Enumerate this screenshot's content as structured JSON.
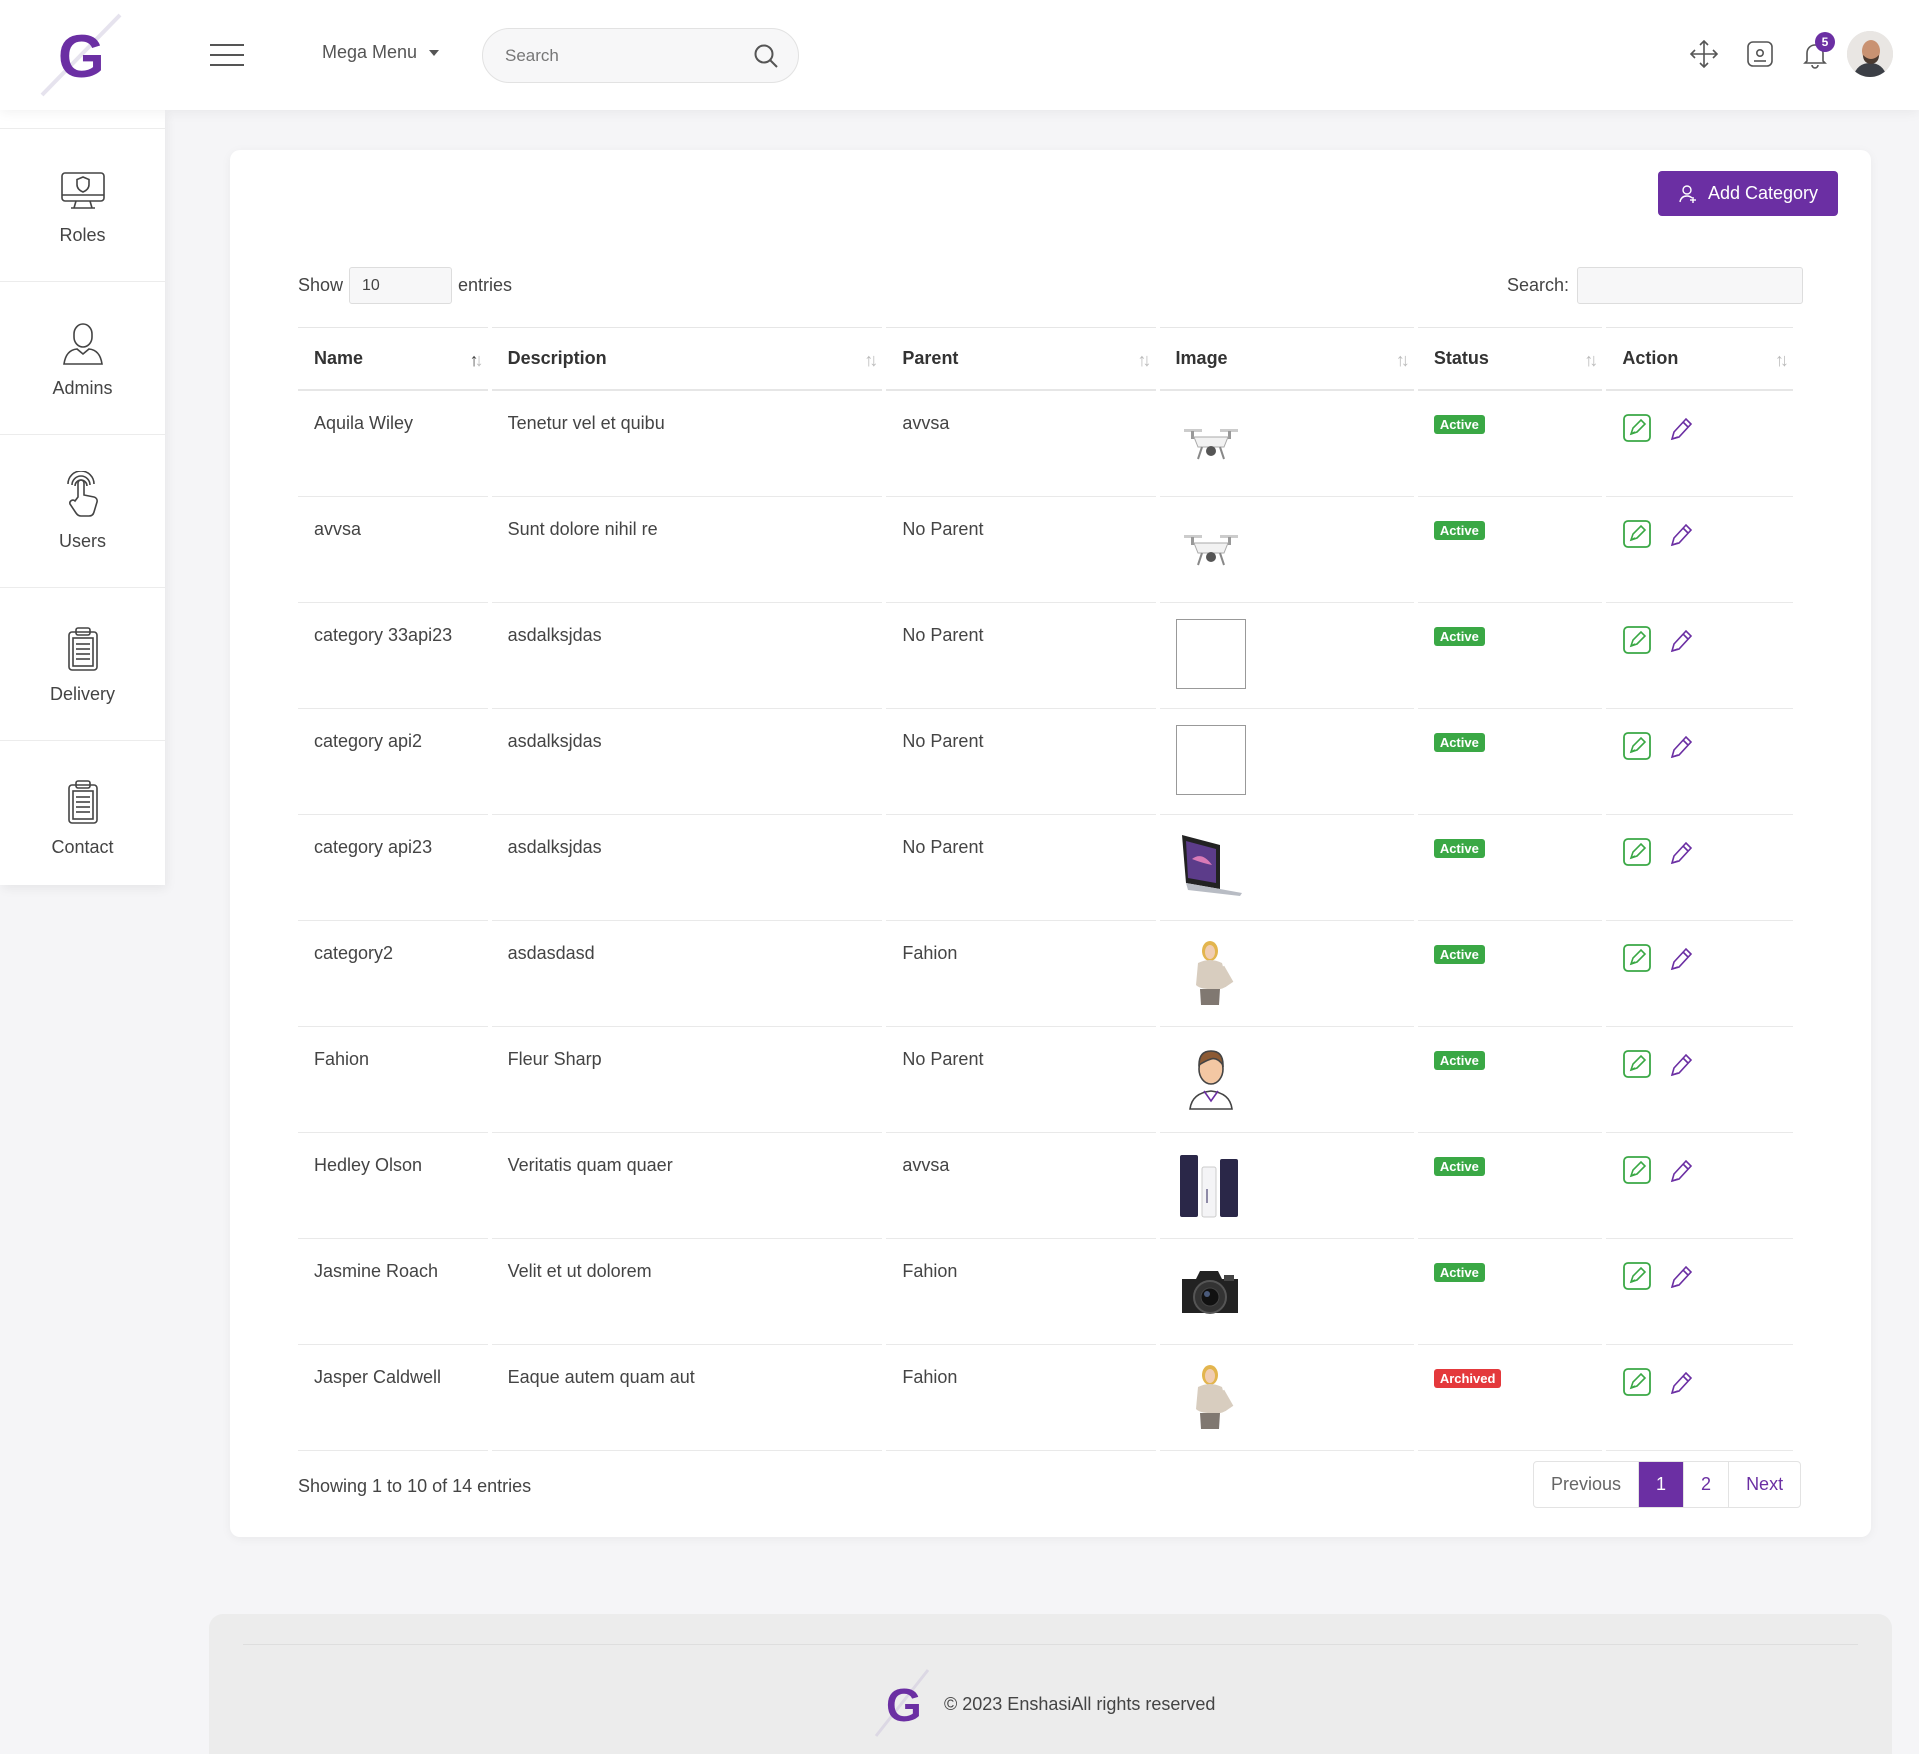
{
  "header": {
    "logo_letter": "G",
    "mega_menu": "Mega Menu",
    "search_placeholder": "Search",
    "notification_count": "5",
    "accent": "#6b2fa3"
  },
  "sidebar": {
    "items": [
      {
        "label": "Roles",
        "icon": "monitor-shield-icon"
      },
      {
        "label": "Admins",
        "icon": "user-icon"
      },
      {
        "label": "Users",
        "icon": "hand-pointer-icon"
      },
      {
        "label": "Delivery",
        "icon": "clipboard-icon"
      },
      {
        "label": "Contact",
        "icon": "clipboard-icon"
      }
    ]
  },
  "toolbar": {
    "add_label": "Add Category",
    "show_label": "Show",
    "entries_value": "10",
    "entries_label": "entries",
    "search_label": "Search:"
  },
  "table": {
    "columns": [
      "Name",
      "Description",
      "Parent",
      "Image",
      "Status",
      "Action"
    ],
    "rows": [
      {
        "name": "Aquila Wiley",
        "description": "Tenetur vel et quibu",
        "parent": "avvsa",
        "image": "drone",
        "status": "Active"
      },
      {
        "name": "avvsa",
        "description": "Sunt dolore nihil re",
        "parent": "No Parent",
        "image": "drone",
        "status": "Active"
      },
      {
        "name": "category 33api23",
        "description": "asdalksjdas",
        "parent": "No Parent",
        "image": "blank",
        "status": "Active"
      },
      {
        "name": "category api2",
        "description": "asdalksjdas",
        "parent": "No Parent",
        "image": "blank",
        "status": "Active"
      },
      {
        "name": "category api23",
        "description": "asdalksjdas",
        "parent": "No Parent",
        "image": "laptop",
        "status": "Active"
      },
      {
        "name": "category2",
        "description": "asdasdasd",
        "parent": "Fahion",
        "image": "woman",
        "status": "Active"
      },
      {
        "name": "Fahion",
        "description": "Fleur Sharp",
        "parent": "No Parent",
        "image": "man-avatar",
        "status": "Active"
      },
      {
        "name": "Hedley Olson",
        "description": "Veritatis quam quaer",
        "parent": "avvsa",
        "image": "tubes",
        "status": "Active"
      },
      {
        "name": "Jasmine Roach",
        "description": "Velit et ut dolorem",
        "parent": "Fahion",
        "image": "camera",
        "status": "Active"
      },
      {
        "name": "Jasper Caldwell",
        "description": "Eaque autem quam aut",
        "parent": "Fahion",
        "image": "woman",
        "status": "Archived"
      }
    ],
    "status_colors": {
      "Active": "#3aa845",
      "Archived": "#e4393c"
    }
  },
  "pagination": {
    "info": "Showing 1 to 10 of 14 entries",
    "previous": "Previous",
    "pages": [
      "1",
      "2"
    ],
    "active_page": "1",
    "next": "Next"
  },
  "footer": {
    "logo_letter": "G",
    "copyright": "© 2023 EnshasiAll rights reserved"
  }
}
